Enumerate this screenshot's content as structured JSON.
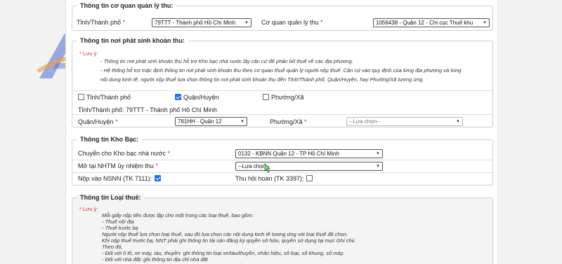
{
  "logo": {
    "text": "ATS"
  },
  "sec1": {
    "legend": "Thông tin cơ quan quản lý thu:",
    "province_label": "Tỉnh/Thành phố",
    "province_value": "79TTT - Thành phố Hồ Chí Minh",
    "agency_label": "Cơ quan quản lý thu",
    "agency_value": "1056438 - Quận 12 - Chi cục Thuế khu"
  },
  "sec2": {
    "legend": "Thông tin nơi phát sinh khoản thu:",
    "note_title": "Lưu ý:",
    "note_lines": [
      "- Thông tin nơi phát sinh khoản thu hỗ trợ Kho bạc nhà nước lấy căn cứ để phân bổ thuế về các địa phương.",
      "- Hệ thống hỗ trợ mặc định thông tin nơi phát sinh khoản thu theo cơ quan thuế quản lý người nộp thuế. Căn cứ vào quy định của từng địa phương và từng",
      "nội dung kinh tế, người nộp thuế lựa chọn thông tin nơi phát sinh khoản thu đến Tỉnh/Thành phố, Quận/Huyện, hay Phường/Xã tương ứng."
    ],
    "cb_province": "Tỉnh/Thành phố",
    "cb_district": "Quận/Huyện",
    "cb_ward": "Phường/Xã",
    "province_line": "Tỉnh/Thành phố: 79TTT - Thành phố Hồ Chí Minh",
    "district_label": "Quận/Huyện",
    "district_value": "761HH - Quận 12",
    "ward_label": "Phường/Xã",
    "ward_value": "--Lựa chọn--"
  },
  "sec3": {
    "legend": "Thông tin Kho Bạc:",
    "treasury_label": "Chuyển cho Kho bạc nhà nước",
    "treasury_value": "0132 - KBNN Quận 12 - TP Hồ Chí Minh",
    "bank_label": "Mở tại NHTM ủy nhiệm thu",
    "bank_value": "--Lựa chọn--",
    "nsnn_label": "Nộp vào NSNN (TK 7111):",
    "refund_label": "Thu hồi hoàn (TK 3397):"
  },
  "sec4": {
    "legend": "Thông tin Loại thuế:",
    "note_title": "Lưu ý:",
    "note_lines": [
      "Mỗi giấy nộp tiền được lập cho một trong các loại thuế, bao gồm:",
      "- Thuế nội địa",
      "- Thuế trước bạ",
      "Người nộp thuế lựa chọn loại thuế, sau đó lựa chọn các nội dung kinh tế tương ứng với loại thuế đã chọn.",
      "Khi nộp thuế trước bạ, NNT phải ghi thông tin tài sản đăng ký quyền sở hữu, quyền sử dụng tại mục Ghi chú",
      "Theo đó,",
      "- Đối với ô tô, xe máy, tàu, thuyền: ghi thông tin loại xe/tàu/thuyền, nhãn hiệu, số loại, số khung, số máy.",
      "- Đối với nhà đất: ghi thông tin địa chỉ nhà đất"
    ]
  }
}
